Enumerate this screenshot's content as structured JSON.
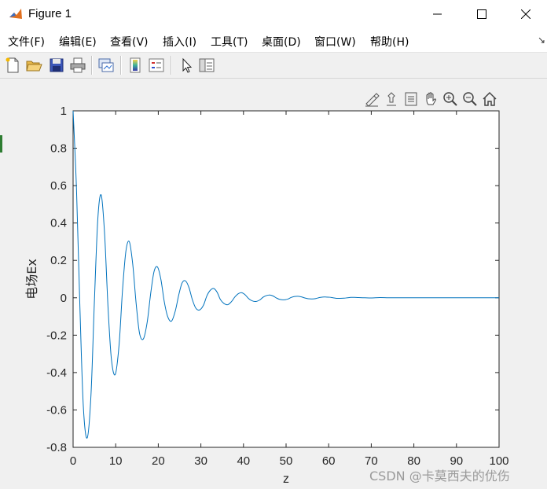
{
  "window": {
    "title": "Figure 1",
    "icon": "matlab-icon"
  },
  "menubar": {
    "items": [
      {
        "label": "文件(F)",
        "name": "menu-file"
      },
      {
        "label": "编辑(E)",
        "name": "menu-edit"
      },
      {
        "label": "查看(V)",
        "name": "menu-view"
      },
      {
        "label": "插入(I)",
        "name": "menu-insert"
      },
      {
        "label": "工具(T)",
        "name": "menu-tools"
      },
      {
        "label": "桌面(D)",
        "name": "menu-desktop"
      },
      {
        "label": "窗口(W)",
        "name": "menu-window"
      },
      {
        "label": "帮助(H)",
        "name": "menu-help"
      }
    ]
  },
  "toolbar": {
    "icons": [
      "new-figure-icon",
      "open-file-icon",
      "save-icon",
      "print-icon",
      "link-plot-icon",
      "colorbar-icon",
      "legend-icon",
      "pointer-icon",
      "property-inspector-icon"
    ]
  },
  "axes_toolbar": {
    "icons": [
      "brush-icon",
      "data-tips-icon",
      "restore-view-icon",
      "pan-icon",
      "zoom-in-icon",
      "zoom-out-icon",
      "home-icon"
    ]
  },
  "watermark": "CSDN @卡莫西夫的优伤",
  "chart_data": {
    "type": "line",
    "title": "",
    "xlabel": "z",
    "ylabel": "电场Ex",
    "xlim": [
      0,
      100
    ],
    "ylim": [
      -0.8,
      1
    ],
    "xticks": [
      "0",
      "10",
      "20",
      "30",
      "40",
      "50",
      "60",
      "70",
      "80",
      "90",
      "100"
    ],
    "yticks": [
      "1",
      "0.8",
      "0.6",
      "0.4",
      "0.2",
      "0",
      "-0.2",
      "-0.4",
      "-0.6",
      "-0.8"
    ],
    "grid": false,
    "line_color": "#0072bd",
    "series": [
      {
        "x": [
          0,
          0.8,
          1.6,
          2.4,
          3.3,
          4.2,
          5.0,
          5.8,
          6.6,
          7.4,
          8.2,
          9.0,
          9.9,
          10.8,
          11.6,
          12.4,
          13.2,
          14.0,
          14.8,
          15.6,
          16.5,
          17.4,
          18.2,
          19.0,
          19.8,
          20.6,
          21.4,
          22.2,
          23.1,
          24.0,
          24.8,
          25.6,
          26.4,
          27.2,
          28.0,
          28.8,
          29.7,
          30.6,
          31.4,
          32.2,
          33.0,
          33.8,
          34.6,
          35.4,
          36.3,
          37.2,
          38.0,
          38.8,
          39.6,
          40.4,
          41.2,
          42.0,
          42.9,
          43.8,
          44.6,
          45.4,
          46.2,
          47.0,
          47.8,
          48.6,
          49.5,
          50.4,
          51.2,
          52.0,
          52.8,
          53.6,
          54.4,
          55.2,
          56.1,
          57.0,
          57.8,
          58.6,
          59.4,
          60.2,
          61.0,
          61.8,
          62.7,
          63.6,
          64.4,
          65.2,
          66.0,
          67.0,
          68.5,
          70.0,
          72.0,
          74.0,
          76.0,
          78.0,
          80.0,
          85.0,
          90.0,
          95.0,
          100.0
        ],
        "y": [
          1.0,
          0.58,
          -0.05,
          -0.58,
          -0.75,
          -0.52,
          -0.02,
          0.42,
          0.55,
          0.34,
          -0.05,
          -0.33,
          -0.41,
          -0.25,
          0.04,
          0.25,
          0.3,
          0.18,
          -0.03,
          -0.19,
          -0.22,
          -0.13,
          0.02,
          0.14,
          0.165,
          0.1,
          -0.02,
          -0.1,
          -0.125,
          -0.07,
          0.015,
          0.08,
          0.09,
          0.055,
          -0.01,
          -0.055,
          -0.065,
          -0.04,
          0.01,
          0.04,
          0.05,
          0.03,
          -0.01,
          -0.03,
          -0.037,
          -0.02,
          0.005,
          0.022,
          0.027,
          0.016,
          -0.004,
          -0.016,
          -0.02,
          -0.012,
          0.003,
          0.012,
          0.015,
          0.009,
          -0.002,
          -0.009,
          -0.011,
          -0.007,
          0.002,
          0.007,
          0.008,
          0.005,
          -0.001,
          -0.005,
          -0.006,
          -0.004,
          0.001,
          0.004,
          0.004,
          0.003,
          0.0,
          -0.003,
          -0.003,
          -0.002,
          0.0,
          0.002,
          0.002,
          0.001,
          0.0,
          -0.001,
          0.001,
          0.0,
          0.0,
          0.0,
          0.0,
          0.0,
          0.0,
          0.0,
          0.0
        ]
      }
    ]
  }
}
